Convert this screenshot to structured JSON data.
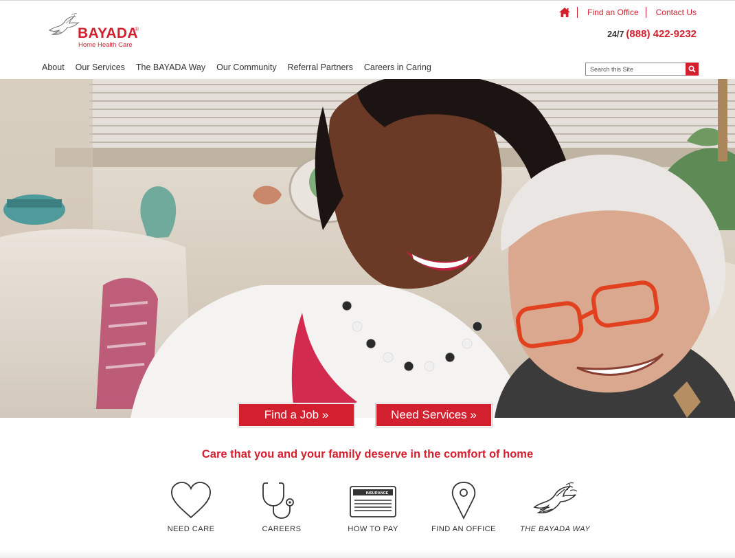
{
  "brand": {
    "name": "BAYADA",
    "registered": "®",
    "subtitle": "Home Health Care",
    "color": "#d3202f"
  },
  "utility": {
    "home_icon": "home-icon",
    "find_office": "Find an Office",
    "contact_us": "Contact Us"
  },
  "phone": {
    "prefix": "24/7",
    "number": "(888) 422-9232"
  },
  "nav": {
    "items": [
      {
        "label": "About"
      },
      {
        "label": "Our Services"
      },
      {
        "label": "The BAYADA Way"
      },
      {
        "label": "Our Community"
      },
      {
        "label": "Referral Partners"
      },
      {
        "label": "Careers in Caring"
      }
    ]
  },
  "search": {
    "placeholder": "Search this Site",
    "icon": "search-icon"
  },
  "hero": {
    "cta_job": "Find a Job »",
    "cta_services": "Need Services »"
  },
  "tagline": "Care that you and your family deserve in the comfort of home",
  "quick_links": [
    {
      "label": "NEED CARE",
      "icon": "heart-icon"
    },
    {
      "label": "CAREERS",
      "icon": "stethoscope-icon"
    },
    {
      "label": "HOW TO PAY",
      "icon": "insurance-card-icon",
      "card_text": "INSURANCE"
    },
    {
      "label": "FIND AN OFFICE",
      "icon": "map-pin-icon"
    },
    {
      "label": "THE BAYADA WAY",
      "icon": "dove-icon"
    }
  ]
}
